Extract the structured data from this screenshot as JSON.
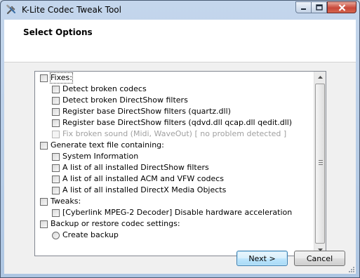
{
  "window": {
    "title": "K-Lite Codec Tweak Tool"
  },
  "header": {
    "title": "Select Options"
  },
  "options": [
    {
      "label": "Fixes:",
      "indent": 0,
      "kind": "checkbox",
      "disabled": false,
      "focused": true
    },
    {
      "label": "Detect broken codecs",
      "indent": 1,
      "kind": "checkbox",
      "disabled": false
    },
    {
      "label": "Detect broken DirectShow filters",
      "indent": 1,
      "kind": "checkbox",
      "disabled": false
    },
    {
      "label": "Register base DirectShow filters (quartz.dll)",
      "indent": 1,
      "kind": "checkbox",
      "disabled": false
    },
    {
      "label": "Register base DirectShow filters (qdvd.dll qcap.dll qedit.dll)",
      "indent": 1,
      "kind": "checkbox",
      "disabled": false
    },
    {
      "label": "Fix broken sound  (Midi, WaveOut)   [ no problem detected ]",
      "indent": 1,
      "kind": "checkbox",
      "disabled": true
    },
    {
      "label": "Generate text file containing:",
      "indent": 0,
      "kind": "checkbox",
      "disabled": false
    },
    {
      "label": "System Information",
      "indent": 1,
      "kind": "checkbox",
      "disabled": false
    },
    {
      "label": "A list of all installed DirectShow filters",
      "indent": 1,
      "kind": "checkbox",
      "disabled": false
    },
    {
      "label": "A list of all installed ACM and VFW codecs",
      "indent": 1,
      "kind": "checkbox",
      "disabled": false
    },
    {
      "label": "A list of all installed DirectX Media Objects",
      "indent": 1,
      "kind": "checkbox",
      "disabled": false
    },
    {
      "label": "Tweaks:",
      "indent": 0,
      "kind": "checkbox",
      "disabled": false
    },
    {
      "label": "[Cyberlink MPEG-2 Decoder]  Disable hardware acceleration",
      "indent": 1,
      "kind": "checkbox",
      "disabled": false
    },
    {
      "label": "Backup or restore codec settings:",
      "indent": 0,
      "kind": "checkbox",
      "disabled": false
    },
    {
      "label": "Create backup",
      "indent": 1,
      "kind": "radio",
      "disabled": false
    }
  ],
  "buttons": {
    "next": "Next >",
    "cancel": "Cancel"
  },
  "colors": {
    "accent": "#3c7fb1",
    "close_button": "#c8483a"
  }
}
